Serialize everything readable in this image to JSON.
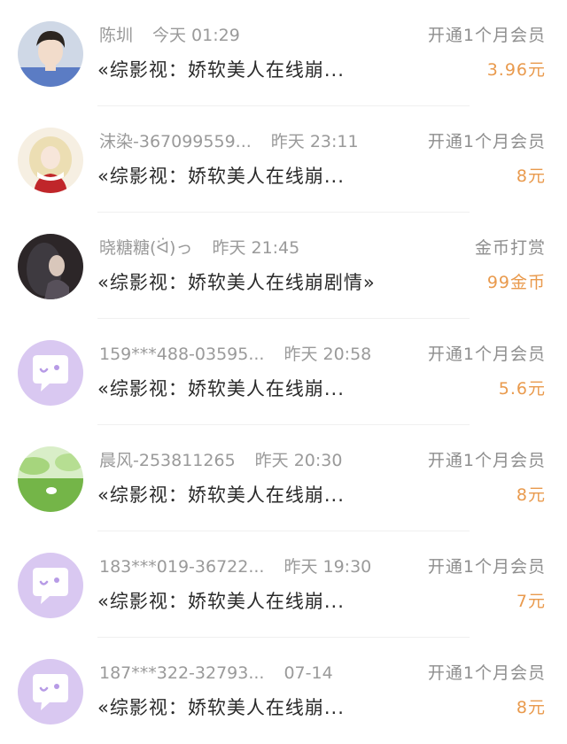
{
  "colors": {
    "accent": "#e99a4d",
    "muted": "#9a9a9a",
    "text": "#2a2a2a",
    "default_avatar": "#d9c8f1"
  },
  "records": [
    {
      "avatar": "photo-avatar-young-man",
      "name": "陈圳",
      "time": "今天 01:29",
      "message": "«综影视：娇软美人在线崩...",
      "action": "开通1个月会员",
      "amount": "3.96元"
    },
    {
      "avatar": "photo-avatar-anime-girl",
      "name": "沫染-367099559...",
      "time": "昨天 23:11",
      "message": "«综影视：娇软美人在线崩...",
      "action": "开通1个月会员",
      "amount": "8元"
    },
    {
      "avatar": "photo-avatar-dark-figure",
      "name": "晓糖糖(ᐛ)っ",
      "time": "昨天 21:45",
      "message": "«综影视：娇软美人在线崩剧情»",
      "action": "金币打赏",
      "amount": "99金币"
    },
    {
      "avatar": "default-chat-icon",
      "name": "159***488-03595...",
      "time": "昨天 20:58",
      "message": "«综影视：娇软美人在线崩...",
      "action": "开通1个月会员",
      "amount": "5.6元"
    },
    {
      "avatar": "photo-avatar-green-meadow",
      "name": "晨风-253811265",
      "time": "昨天 20:30",
      "message": "«综影视：娇软美人在线崩...",
      "action": "开通1个月会员",
      "amount": "8元"
    },
    {
      "avatar": "default-chat-icon",
      "name": "183***019-36722...",
      "time": "昨天 19:30",
      "message": "«综影视：娇软美人在线崩...",
      "action": "开通1个月会员",
      "amount": "7元"
    },
    {
      "avatar": "default-chat-icon",
      "name": "187***322-32793...",
      "time": "07-14",
      "message": "«综影视：娇软美人在线崩...",
      "action": "开通1个月会员",
      "amount": "8元"
    }
  ]
}
